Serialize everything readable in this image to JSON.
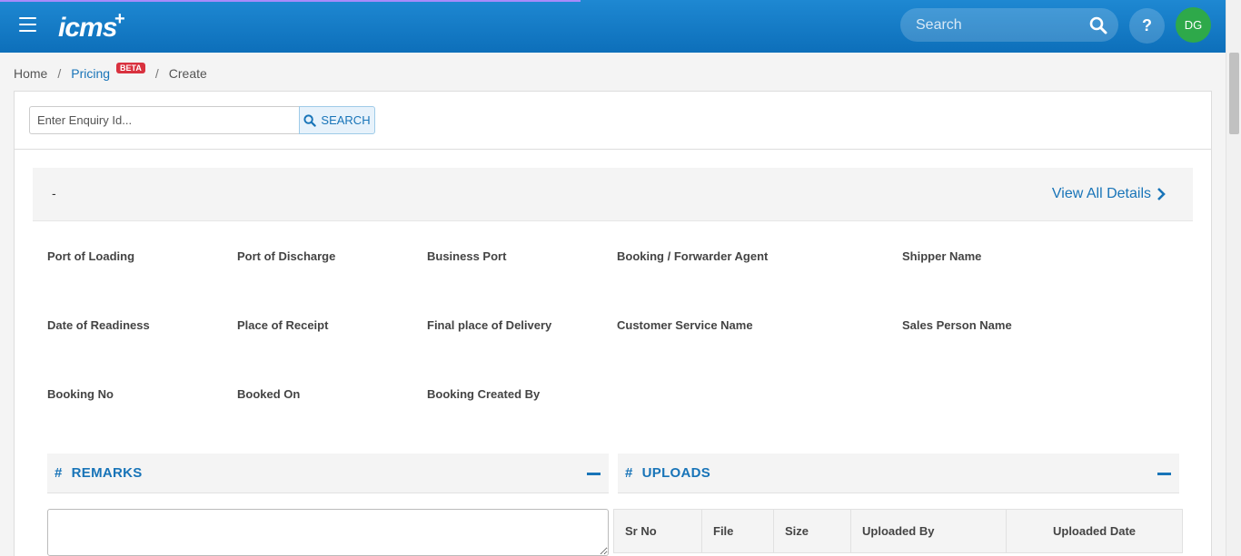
{
  "header": {
    "logo_text": "icms",
    "logo_plus": "+",
    "search_placeholder": "Search",
    "help_label": "?",
    "avatar_initials": "DG",
    "avatar_color": "#2ea94a",
    "brand_color": "#1874b8"
  },
  "breadcrumb": {
    "home": "Home",
    "separator": "/",
    "pricing": "Pricing",
    "badge": "BETA",
    "create": "Create"
  },
  "enquiry": {
    "placeholder": "Enter Enquiry Id...",
    "search_label": "SEARCH"
  },
  "summary": {
    "title": "-",
    "view_all": "View All Details"
  },
  "fields": [
    "Port of Loading",
    "Port of Discharge",
    "Business Port",
    "Booking / Forwarder Agent",
    "Shipper Name",
    "Date of Readiness",
    "Place of Receipt",
    "Final place of Delivery",
    "Customer Service Name",
    "Sales Person Name",
    "Booking No",
    "Booked On",
    "Booking Created By"
  ],
  "remarks": {
    "hash": "#",
    "title": "REMARKS"
  },
  "uploads": {
    "hash": "#",
    "title": "UPLOADS",
    "columns": [
      "Sr No",
      "File",
      "Size",
      "Uploaded By",
      "Uploaded Date"
    ]
  }
}
